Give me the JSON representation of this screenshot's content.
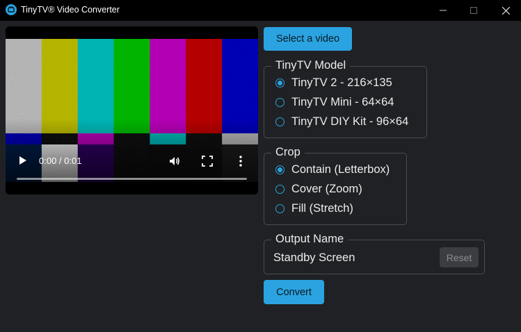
{
  "window": {
    "title": "TinyTV® Video Converter"
  },
  "video_player": {
    "time": "0:00 / 0:01",
    "progress_fraction": 0.0,
    "bar_colors": [
      "#c0c0c0",
      "#c0c000",
      "#00c0c0",
      "#00c000",
      "#c000c0",
      "#c00000",
      "#0000c0"
    ]
  },
  "actions": {
    "select_video_label": "Select a video",
    "convert_label": "Convert"
  },
  "model": {
    "legend": "TinyTV Model",
    "options": [
      {
        "label": "TinyTV 2 - 216×135",
        "checked": true
      },
      {
        "label": "TinyTV Mini - 64×64",
        "checked": false
      },
      {
        "label": "TinyTV DIY Kit - 96×64",
        "checked": false
      }
    ]
  },
  "crop": {
    "legend": "Crop",
    "options": [
      {
        "label": "Contain (Letterbox)",
        "checked": true
      },
      {
        "label": "Cover (Zoom)",
        "checked": false
      },
      {
        "label": "Fill (Stretch)",
        "checked": false
      }
    ]
  },
  "output": {
    "legend": "Output Name",
    "value": "Standby Screen",
    "reset_label": "Reset"
  },
  "colors": {
    "accent": "#2aa3e0",
    "background": "#202124",
    "titlebar": "#000000"
  }
}
